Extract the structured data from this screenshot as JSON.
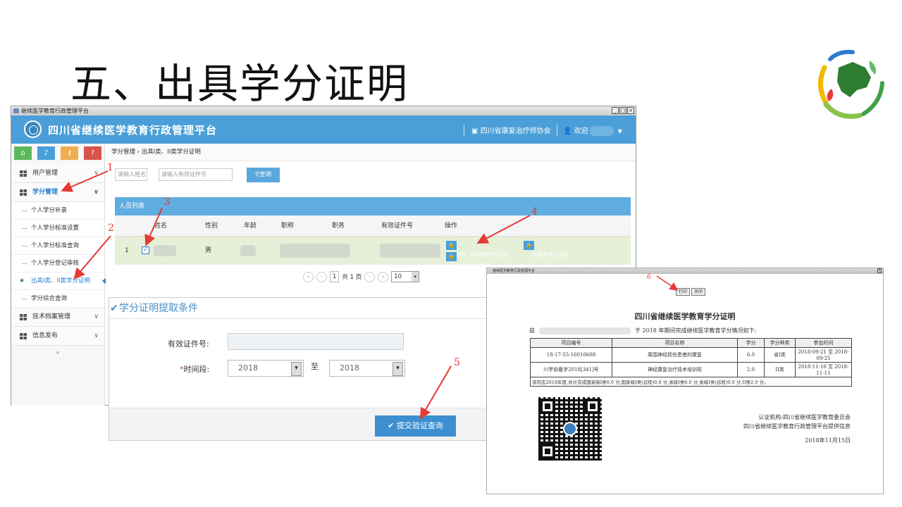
{
  "slide": {
    "title": "五、出具学分证明"
  },
  "window": {
    "title": "继续医学教育行政管理平台"
  },
  "header": {
    "brand": "四川省继续医学教育行政管理平台",
    "org": "四川省康复治疗师协会",
    "welcome": "欢迎"
  },
  "sidebar": {
    "menu": [
      {
        "label": "用户管理"
      },
      {
        "label": "学分管理"
      },
      {
        "label": "技术档案管理"
      },
      {
        "label": "信息发布"
      }
    ],
    "sub_items": [
      {
        "label": "个人学分补录"
      },
      {
        "label": "个人学分标准设置"
      },
      {
        "label": "个人学分标准查询"
      },
      {
        "label": "个人学分登记审核"
      },
      {
        "label": "出具I类、II类学分证明"
      },
      {
        "label": "学分综合查询"
      }
    ]
  },
  "breadcrumb": "学分管理 › 出具I类、II类学分证明",
  "search": {
    "name_placeholder": "请输入姓名",
    "id_placeholder": "请输入有效证件号",
    "button": "查询"
  },
  "table": {
    "panel_title": "人员列表",
    "columns": [
      "姓名",
      "性别",
      "年龄",
      "职称",
      "职务",
      "有效证件号",
      "操作"
    ],
    "rows": [
      {
        "index": "1",
        "gender": "男",
        "actions": [
          "合成I、II类综合学分证明",
          "合成I类学分证明",
          "合成II类学分证明"
        ]
      }
    ]
  },
  "pager": {
    "page": "1",
    "total": "共 1 页",
    "size": "10"
  },
  "dialog": {
    "title": "学分证明提取条件",
    "id_label": "有效证件号:",
    "period_label": "时间段:",
    "from_year": "2018",
    "to_label": "至",
    "to_year": "2018",
    "submit": "提交验证查询"
  },
  "certificate": {
    "window_title": "继续医学教育行政管理平台",
    "print": "打印",
    "close": "关闭",
    "title": "四川省继续医学教育学分证明",
    "intro_prefix": "兹",
    "intro": "于 2018 年期间完成继续医学教育学分情况如下:",
    "columns": [
      "项目编号",
      "项目名称",
      "学分",
      "学分种类",
      "参加时间"
    ],
    "rows": [
      {
        "code": "18-17-55-16010608",
        "name": "周围神经损伤患者的康复",
        "credit": "6.0",
        "type": "省I类",
        "date": "2018-09-21 至 2018-09-25"
      },
      {
        "code": "川学协备字2018[341]号",
        "name": "神经康复治疗技术培训班",
        "credit": "2.0",
        "type": "II类",
        "date": "2018-11-10 至 2018-11-11"
      }
    ],
    "summary": "该同志2018年度,共计完成国家级I类0.0 分,国家级I类(远程)0.0 分,省级I类6.0 分,省级I类(远程)0.0 分,II类2.0 分。",
    "authority": "认证机构:四川省继续医学教育委员会",
    "provider": "四川省继续医学教育行政管理平台提供信息",
    "date": "2018年11月15日"
  },
  "annotations": [
    "1",
    "2",
    "3",
    "4",
    "5",
    "6"
  ],
  "colors": {
    "accent": "#4a9fd8",
    "arrow": "#e53935",
    "row_highlight": "#e6efd8"
  }
}
